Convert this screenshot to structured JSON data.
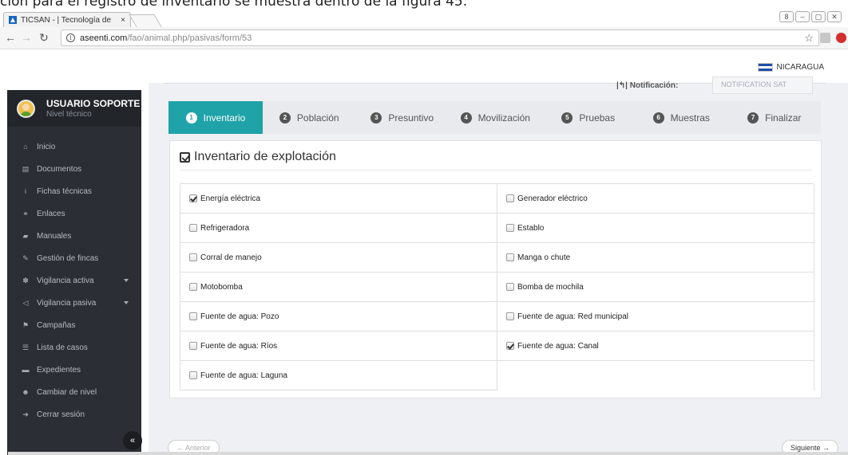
{
  "caption": "ción para el registro de inventario se muestra dentro de la figura 45.",
  "browser": {
    "tab_title": "TICSAN - | Tecnología de",
    "tab_close": "×",
    "url_host": "aseenti.com",
    "url_path": "/fao/animal.php/pasivas/form/53",
    "win_controls": [
      "8",
      "–",
      "▢",
      "✕"
    ]
  },
  "country": "NICARAGUA",
  "user": {
    "name": "USUARIO SOPORTE",
    "level": "Nivel técnico"
  },
  "sidebar": {
    "items": [
      {
        "label": "Inicio",
        "icon": "home-icon",
        "glyph": "⌂"
      },
      {
        "label": "Documentos",
        "icon": "file-icon",
        "glyph": "▤"
      },
      {
        "label": "Fichas técnicas",
        "icon": "info-icon",
        "glyph": "i"
      },
      {
        "label": "Enlaces",
        "icon": "link-icon",
        "glyph": "⚭"
      },
      {
        "label": "Manuales",
        "icon": "book-icon",
        "glyph": "▰"
      },
      {
        "label": "Gestión de fincas",
        "icon": "edit-icon",
        "glyph": "✎"
      },
      {
        "label": "Vigilancia activa",
        "icon": "paw-icon",
        "glyph": "✽",
        "caret": true
      },
      {
        "label": "Vigilancia pasiva",
        "icon": "bullhorn-icon",
        "glyph": "◁",
        "caret": true
      },
      {
        "label": "Campañas",
        "icon": "flag-icon",
        "glyph": "⚑"
      },
      {
        "label": "Lista de casos",
        "icon": "list-icon",
        "glyph": "☰"
      },
      {
        "label": "Expedientes",
        "icon": "folder-icon",
        "glyph": "▬"
      },
      {
        "label": "Cambiar de nivel",
        "icon": "users-icon",
        "glyph": "☻"
      },
      {
        "label": "Cerrar sesión",
        "icon": "sign-out-icon",
        "glyph": "➜"
      }
    ],
    "collapse_glyph": "«"
  },
  "notification": {
    "label": "|↰| Notificación:",
    "value": "NOTIFICATION SAT"
  },
  "wizard": {
    "steps": [
      {
        "num": "1",
        "label": "Inventario",
        "active": true
      },
      {
        "num": "2",
        "label": "Población"
      },
      {
        "num": "3",
        "label": "Presuntivo"
      },
      {
        "num": "4",
        "label": "Movilización"
      },
      {
        "num": "5",
        "label": "Pruebas"
      },
      {
        "num": "6",
        "label": "Muestras"
      },
      {
        "num": "7",
        "label": "Finalizar"
      }
    ]
  },
  "panel": {
    "title": "Inventario de explotación",
    "items": [
      {
        "label": "Energía eléctrica",
        "checked": true
      },
      {
        "label": "Generador eléctrico",
        "checked": false
      },
      {
        "label": "Refrigeradora",
        "checked": false
      },
      {
        "label": "Establo",
        "checked": false
      },
      {
        "label": "Corral de manejo",
        "checked": false
      },
      {
        "label": "Manga o chute",
        "checked": false
      },
      {
        "label": "Motobomba",
        "checked": false
      },
      {
        "label": "Bomba de mochila",
        "checked": false
      },
      {
        "label": "Fuente de agua: Pozo",
        "checked": false
      },
      {
        "label": "Fuente de agua: Red municipal",
        "checked": false
      },
      {
        "label": "Fuente de agua: Ríos",
        "checked": false
      },
      {
        "label": "Fuente de agua: Canal",
        "checked": true
      },
      {
        "label": "Fuente de agua: Laguna",
        "checked": false
      }
    ]
  },
  "buttons": {
    "prev": "← Anterior",
    "next": "Siguiente →"
  },
  "colors": {
    "accent": "#1fa3a8",
    "sidebar": "#2b2f35"
  }
}
